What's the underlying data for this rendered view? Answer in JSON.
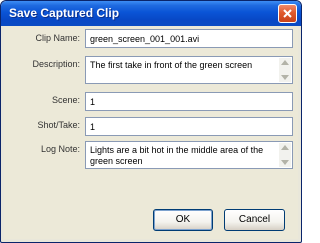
{
  "window": {
    "title": "Save Captured Clip"
  },
  "form": {
    "clip_name": {
      "label": "Clip Name:",
      "value": "green_screen_001_001.avi"
    },
    "description": {
      "label": "Description:",
      "value": "The first take in front of the green screen"
    },
    "scene": {
      "label": "Scene:",
      "value": "1"
    },
    "shot_take": {
      "label": "Shot/Take:",
      "value": "1"
    },
    "log_note": {
      "label": "Log Note:",
      "value": "Lights are a bit hot in the middle area of the green screen"
    }
  },
  "buttons": {
    "ok_label": "OK",
    "cancel_label": "Cancel"
  },
  "colors": {
    "titlebar": "#0a54d6",
    "dialog_background": "#ece9d8",
    "close_button": "#e05a2e"
  }
}
